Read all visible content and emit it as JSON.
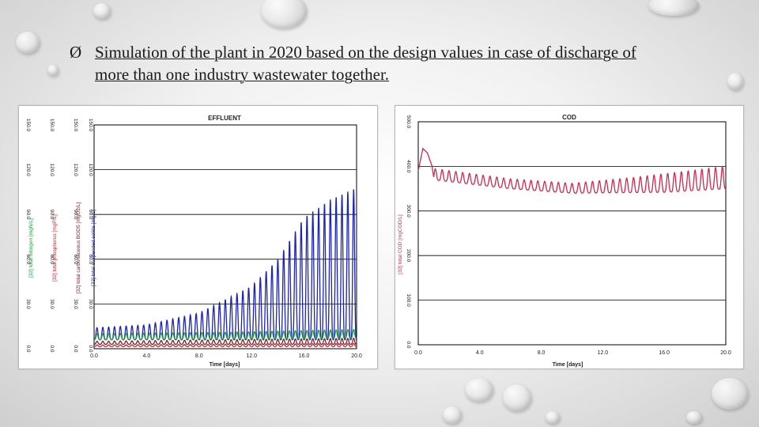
{
  "slide": {
    "bullet": "Ø",
    "text_line1": "Simulation of the plant in 2020 based on the design values in case of discharge of",
    "text_line2": "more than one  industry wastewater together."
  },
  "colors": {
    "nitrogen": "#1f9d3a",
    "phosphorus": "#d0202a",
    "suspended_solids": "#1c24b8",
    "cod": "#d4264e"
  },
  "chart_data": [
    {
      "type": "line",
      "title": "EFFLUENT",
      "xlabel": "Time [days]",
      "x_ticks": [
        "0.0",
        "4.0",
        "8.0",
        "12.0",
        "16.0",
        "20.0"
      ],
      "xlim": [
        0,
        20
      ],
      "grid": true,
      "y_axes": [
        {
          "label": "[32] total nitrogen [mgN/L]",
          "ticks": [
            "0.0",
            "30.0",
            "60.0",
            "90.0",
            "120.0",
            "150.0"
          ],
          "ylim": [
            0,
            150
          ]
        },
        {
          "label": "[32] total phosphorus [mgP/L]",
          "ticks": [
            "0.0",
            "30.0",
            "60.0",
            "90.0",
            "120.0",
            "150.0"
          ],
          "ylim": [
            0,
            150
          ]
        },
        {
          "label": "[32] total carbonaceous BOD5 [mgO2/L]",
          "ticks": [
            "0.0",
            "30.0",
            "60.0",
            "90.0",
            "120.0",
            "150.0"
          ],
          "ylim": [
            0,
            150
          ]
        },
        {
          "label": "[32] total suspended solids [mg/L]",
          "ticks": [
            "0.0",
            "30.0",
            "60.0",
            "90.0",
            "120.0",
            "150.0"
          ],
          "ylim": [
            0,
            150
          ]
        }
      ],
      "series": [
        {
          "name": "[32] total suspended solids [mg/L]",
          "color": "#1c24b8",
          "periods_per_day": 2.25,
          "baseline": [
            [
              0,
              6
            ],
            [
              10,
              6
            ],
            [
              20,
              6
            ]
          ],
          "peak": [
            [
              0,
              14
            ],
            [
              4,
              16
            ],
            [
              8,
              24
            ],
            [
              12,
              42
            ],
            [
              14,
              60
            ],
            [
              16,
              88
            ],
            [
              18,
              100
            ],
            [
              20,
              108
            ]
          ]
        },
        {
          "name": "[32] total nitrogen [mgN/L]",
          "color": "#1f9d3a",
          "periods_per_day": 2.25,
          "baseline": [
            [
              0,
              6
            ],
            [
              20,
              7
            ]
          ],
          "peak": [
            [
              0,
              10
            ],
            [
              10,
              11
            ],
            [
              20,
              13
            ]
          ]
        },
        {
          "name": "[32] total carbonaceous BOD5 [mgO2/L]",
          "color": "#7a1e2a",
          "periods_per_day": 2.25,
          "baseline": [
            [
              0,
              3
            ],
            [
              20,
              3
            ]
          ],
          "peak": [
            [
              0,
              5
            ],
            [
              20,
              7
            ]
          ]
        },
        {
          "name": "[32] total phosphorus [mgP/L]",
          "color": "#d0202a",
          "periods_per_day": 2.25,
          "baseline": [
            [
              0,
              1.5
            ],
            [
              20,
              1.5
            ]
          ],
          "peak": [
            [
              0,
              2.5
            ],
            [
              20,
              3.5
            ]
          ]
        }
      ]
    },
    {
      "type": "line",
      "title": "COD",
      "xlabel": "Time [days]",
      "ylabel": "[32] total COD [mgCOD/L]",
      "x_ticks": [
        "0.0",
        "4.0",
        "8.0",
        "12.0",
        "16.0",
        "20.0"
      ],
      "y_ticks": [
        "0.0",
        "100.0",
        "200.0",
        "300.0",
        "400.0",
        "500.0"
      ],
      "xlim": [
        0,
        20
      ],
      "ylim": [
        0,
        500
      ],
      "grid": true,
      "series": [
        {
          "name": "[32] total COD [mgCOD/L]",
          "color": "#d4264e",
          "periods_per_day": 2.25,
          "initial": [
            [
              0,
              390
            ],
            [
              0.3,
              440
            ],
            [
              0.6,
              430
            ],
            [
              0.9,
              400
            ]
          ],
          "baseline": [
            [
              1,
              370
            ],
            [
              6,
              350
            ],
            [
              10,
              340
            ],
            [
              16,
              342
            ],
            [
              20,
              350
            ]
          ],
          "peak": [
            [
              1,
              395
            ],
            [
              6,
              372
            ],
            [
              10,
              362
            ],
            [
              14,
              375
            ],
            [
              20,
              400
            ]
          ]
        }
      ]
    }
  ]
}
